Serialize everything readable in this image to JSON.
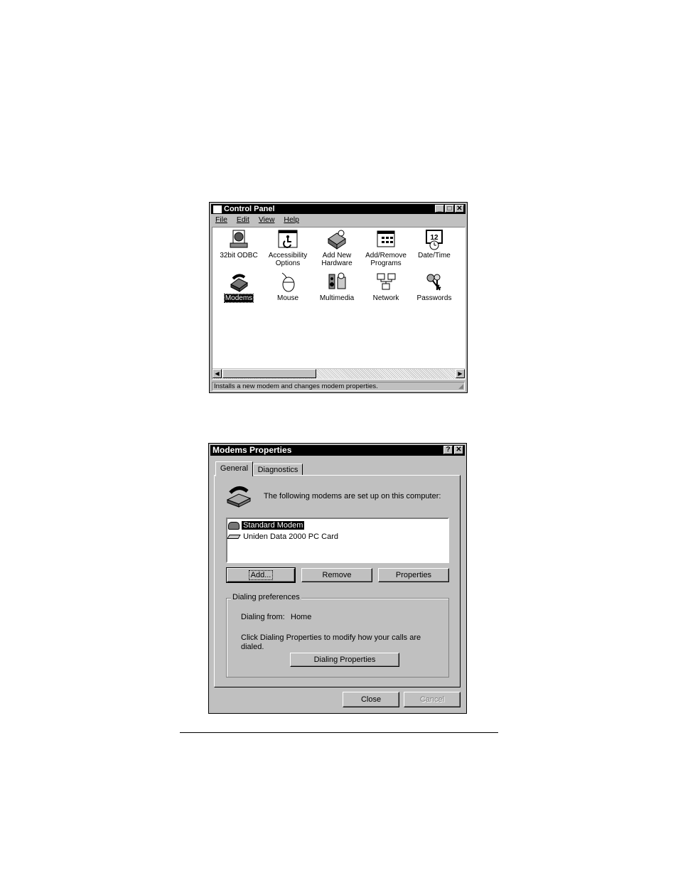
{
  "control_panel": {
    "title": "Control Panel",
    "menu": [
      "File",
      "Edit",
      "View",
      "Help"
    ],
    "items": [
      {
        "label": "32bit ODBC",
        "icon": "odbc-icon"
      },
      {
        "label": "Accessibility Options",
        "icon": "accessibility-icon"
      },
      {
        "label": "Add New Hardware",
        "icon": "hardware-icon"
      },
      {
        "label": "Add/Remove Programs",
        "icon": "programs-icon"
      },
      {
        "label": "Date/Time",
        "icon": "datetime-icon"
      },
      {
        "label": "Modems",
        "icon": "modem-icon"
      },
      {
        "label": "Mouse",
        "icon": "mouse-icon"
      },
      {
        "label": "Multimedia",
        "icon": "multimedia-icon"
      },
      {
        "label": "Network",
        "icon": "network-icon"
      },
      {
        "label": "Passwords",
        "icon": "keys-icon"
      }
    ],
    "status": "Installs a new modem and changes modem properties."
  },
  "modems_dialog": {
    "title": "Modems Properties",
    "tabs": [
      "General",
      "Diagnostics"
    ],
    "intro": "The following modems are set up on this computer:",
    "modems": [
      "Standard Modem",
      "Uniden Data 2000 PC Card"
    ],
    "buttons": {
      "add": "Add...",
      "remove": "Remove",
      "properties": "Properties"
    },
    "dialing": {
      "legend": "Dialing preferences",
      "from_label": "Dialing from:",
      "from_value": "Home",
      "hint": "Click Dialing Properties to modify how your calls are dialed.",
      "button": "Dialing Properties"
    },
    "close": "Close",
    "cancel": "Cancel"
  }
}
